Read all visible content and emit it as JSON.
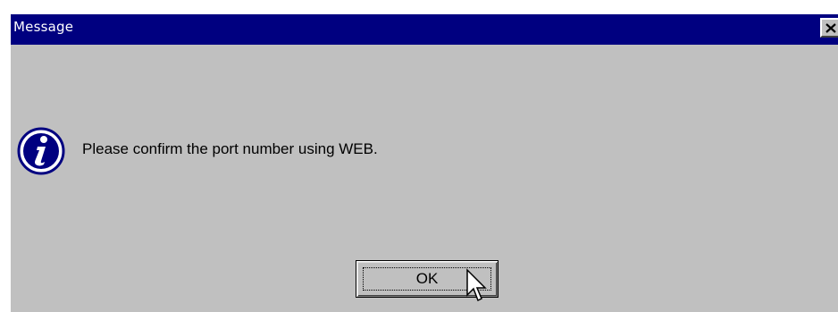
{
  "window": {
    "title": "Message"
  },
  "message": {
    "text": "Please confirm the port number using WEB.",
    "icon": "info-icon"
  },
  "buttons": {
    "ok_label": "OK",
    "close_icon": "close-icon"
  },
  "colors": {
    "titlebar": "#000080",
    "dialog_bg": "#c0c0c0",
    "icon_blue": "#000080"
  }
}
